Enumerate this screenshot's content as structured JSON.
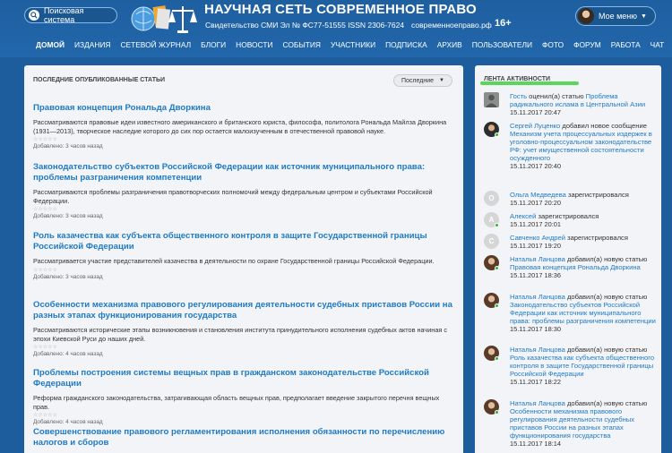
{
  "header": {
    "search_label": "Поисковая система",
    "title": "НАУЧНАЯ СЕТЬ СОВРЕМЕННОЕ ПРАВО",
    "certificate": "Свидетельство СМИ Эл № ФС77-51555 ISSN 2306-7624",
    "domain": "современноеправо.рф",
    "age": "16+",
    "menu_label": "Мое меню"
  },
  "nav": [
    "ДОМОЙ",
    "ИЗДАНИЯ",
    "СЕТЕВОЙ ЖУРНАЛ",
    "БЛОГИ",
    "НОВОСТИ",
    "СОБЫТИЯ",
    "УЧАСТНИКИ",
    "ПОДПИСКА",
    "АРХИВ",
    "ПОЛЬЗОВАТЕЛИ",
    "ФОТО",
    "ФОРУМ",
    "РАБОТА",
    "ЧАТ"
  ],
  "main": {
    "heading": "ПОСЛЕДНИЕ ОПУБЛИКОВАННЫЕ СТАТЬИ",
    "sort_value": "Последние",
    "stars": "☆☆☆☆☆",
    "articles": [
      {
        "title": "Правовая концепция Рональда Дворкина",
        "desc": "Рассматриваются правовые идеи известного американского и британского юриста, философа, политолога Рональда Майлза Дворкина (1931—2013), творческое наследие которого до сих пор остается малоизученным в отечественной правовой науке.",
        "date": "Добавлено: 3 часов назад"
      },
      {
        "title": "Законодательство субъектов Российской Федерации как источник муниципального права: проблемы разграничения компетенции",
        "desc": "Рассматриваются проблемы разграничения правотворческих полномочий между федеральным центром и субъектами Российской Федерации.",
        "date": "Добавлено: 3 часов назад"
      },
      {
        "title": "Роль казачества как субъекта общественного контроля в защите Государственной границы Российской Федерации",
        "desc": "Рассматривается участие представителей казачества в деятельности по охране Государственной границы Российской Федерации.",
        "date": "Добавлено: 3 часов назад"
      },
      {
        "title": "Особенности механизма правового регулирования деятельности судебных приставов России на разных этапах функционирования государства",
        "desc": "Рассматриваются исторические этапы возникновения и становления института принудительного исполнения судебных актов начиная с эпохи Киевской Руси до наших дней.",
        "date": "Добавлено: 4 часов назад"
      },
      {
        "title": "Проблемы построения системы вещных прав в гражданском законодательстве Российской Федерации",
        "desc": "Реформа гражданского законодательства, затрагивающая область вещных прав, предполагает введение закрытого перечня вещных прав.",
        "date": "Добавлено: 4 часов назад"
      },
      {
        "title": "Совершенствование правового регламентирования исполнения обязанности по перечислению налогов и сборов",
        "desc": "",
        "date": ""
      }
    ]
  },
  "side": {
    "heading": "ЛЕНТА АКТИВНОСТИ",
    "items": [
      {
        "user": "Гость",
        "action": " оценил(а) статью ",
        "link": "Проблема радикального ислама в Центральной Азии",
        "time": "15.11.2017 20:47"
      },
      {
        "user": "Сергей Луценко",
        "action": " добавил новое сообщение ",
        "link": "Механизм учета процессуальных издержек в уголовно-процессуальном законодательстве РФ: учет имущественной состоятельности осужденного",
        "time": "15.11.2017 20:40"
      },
      {
        "user": "Ольга Медведева",
        "action": " зарегистрировался",
        "link": "",
        "time": "15.11.2017 20:20",
        "letter": "О"
      },
      {
        "user": "Алексей",
        "action": " зарегистрировался",
        "link": "",
        "time": "15.11.2017 20:01",
        "letter": "А"
      },
      {
        "user": "Савченко Андрей",
        "action": " зарегистрировался",
        "link": "",
        "time": "15.11.2017 19:20",
        "letter": "С"
      },
      {
        "user": "Наталья Ланцова",
        "action": " добавил(а) новую статью ",
        "link": "Правовая концепция Рональда Дворкина",
        "time": "15.11.2017 18:36"
      },
      {
        "user": "Наталья Ланцова",
        "action": " добавил(а) новую статью ",
        "link": "Законодательство субъектов Российской Федерации как источник муниципального права: проблемы разграничения компетенции",
        "time": "15.11.2017 18:30"
      },
      {
        "user": "Наталья Ланцова",
        "action": " добавил(а) новую статью ",
        "link": "Роль казачества как субъекта общественного контроля в защите Государственной границы Российской Федерации",
        "time": "15.11.2017 18:22"
      },
      {
        "user": "Наталья Ланцова",
        "action": " добавил(а) новую статью ",
        "link": "Особенности механизма правового регулирования деятельности судебных приставов России на разных этапах функционирования государства",
        "time": "15.11.2017 18:14"
      }
    ]
  }
}
